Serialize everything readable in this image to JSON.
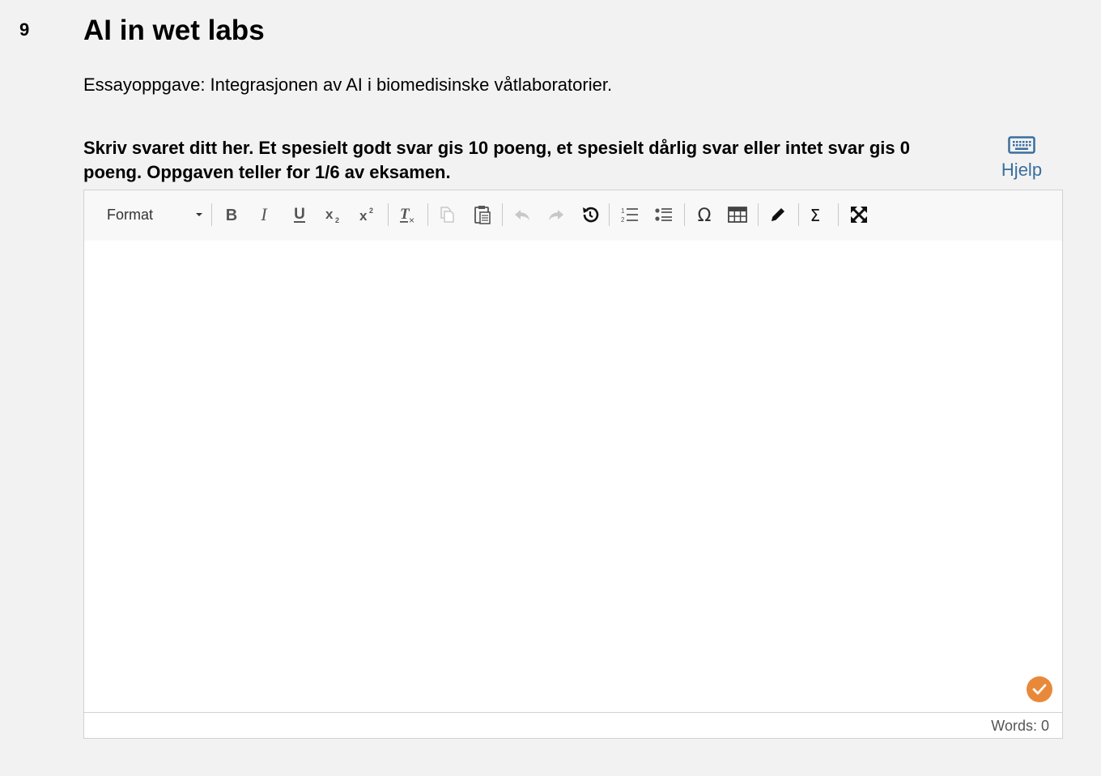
{
  "question": {
    "number": "9",
    "title": "AI in wet labs",
    "description": "Essayoppgave: Integrasjonen av AI i biomedisinske våtlaboratorier.",
    "instructions": "Skriv svaret ditt her. Et spesielt godt svar gis 10 poeng, et spesielt dårlig svar eller intet svar gis 0 poeng. Oppgaven teller for 1/6 av eksamen."
  },
  "help": {
    "label": "Hjelp",
    "icon": "keyboard-icon"
  },
  "toolbar": {
    "format_label": "Format",
    "buttons": [
      "bold",
      "italic",
      "underline",
      "subscript",
      "superscript",
      "remove-format",
      "copy",
      "paste",
      "undo",
      "redo",
      "restore",
      "numbered-list",
      "bulleted-list",
      "special-character",
      "table",
      "draw",
      "math",
      "maximize"
    ]
  },
  "editor": {
    "content": ""
  },
  "status": {
    "words": "Words: 0"
  },
  "colors": {
    "accent": "#3a6e9e",
    "check": "#e8893a",
    "background": "#f2f2f2"
  }
}
